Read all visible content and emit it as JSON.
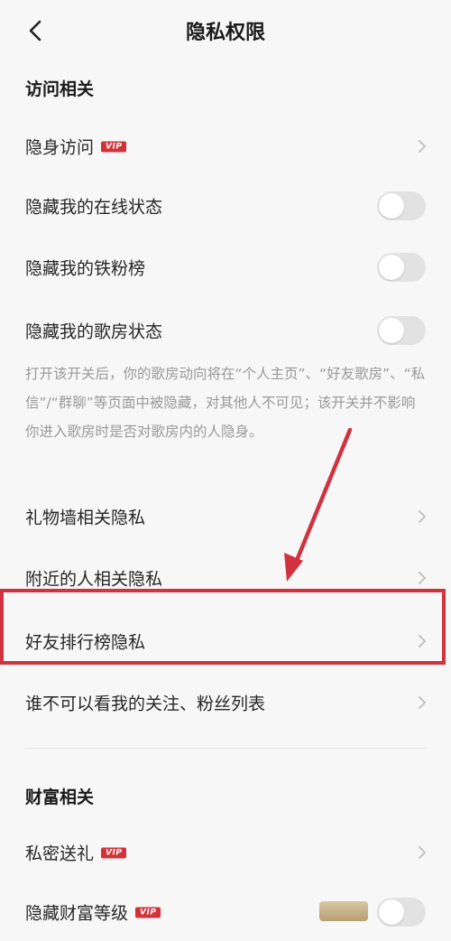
{
  "header": {
    "title": "隐私权限"
  },
  "sections": {
    "access": "访问相关",
    "wealth": "财富相关"
  },
  "rows": {
    "invisible_visit": "隐身访问",
    "hide_online": "隐藏我的在线状态",
    "hide_fans": "隐藏我的铁粉榜",
    "hide_room": "隐藏我的歌房状态",
    "gift_wall": "礼物墙相关隐私",
    "nearby": "附近的人相关隐私",
    "friend_rank": "好友排行榜隐私",
    "who_cannot_see": "谁不可以看我的关注、粉丝列表",
    "private_gift": "私密送礼",
    "hide_wealth": "隐藏财富等级"
  },
  "vip_badge": "VIP",
  "room_description": "打开该开关后，你的歌房动向将在“个人主页”、“好友歌房”、“私信”/“群聊”等页面中被隐藏，对其他人不可见；该开关并不影响你进入歌房时是否对歌房内的人隐身。",
  "toggles": {
    "hide_online": false,
    "hide_fans": false,
    "hide_room": false,
    "hide_wealth": false
  },
  "colors": {
    "accent": "#d1323f",
    "vip": "#d23339",
    "toggle_off": "#e2e2e2"
  },
  "icons": {
    "back": "chevron-left-icon",
    "row_arrow": "chevron-right-icon"
  }
}
